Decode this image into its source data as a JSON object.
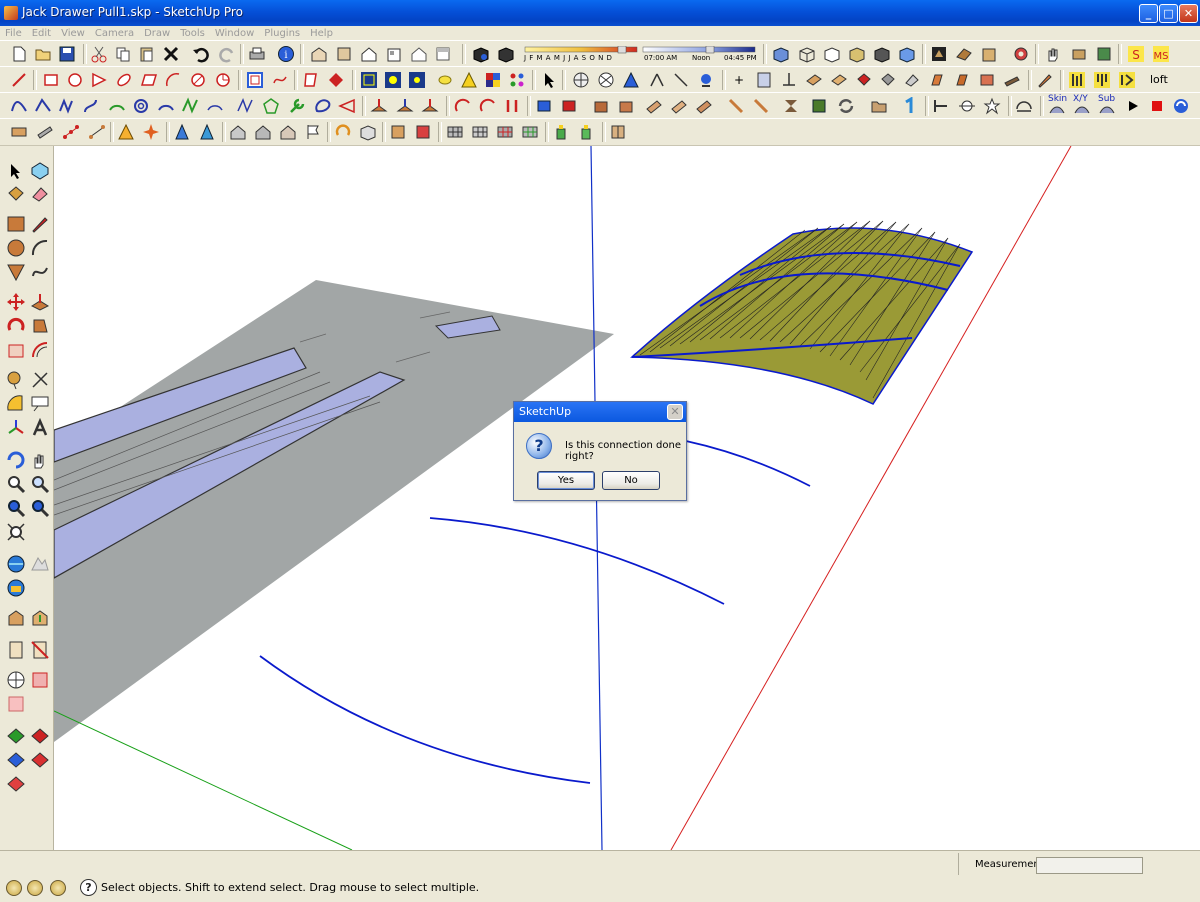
{
  "window": {
    "title": "Jack Drawer Pull1.skp - SketchUp Pro",
    "minimize": "_",
    "maximize": "□",
    "close": "✕"
  },
  "menu": [
    "File",
    "Edit",
    "View",
    "Camera",
    "Draw",
    "Tools",
    "Window",
    "Plugins",
    "Help"
  ],
  "shadow_toolbar": {
    "months": "J F M A M J J A S O N D",
    "time_start": "07:00 AM",
    "time_mid": "Noon",
    "time_end": "04:45 PM"
  },
  "plugin_toolbar": {
    "loft": "loft",
    "skin": "Skin",
    "xy": "X/Y",
    "sub": "Sub"
  },
  "dialog": {
    "title": "SketchUp",
    "icon": "?",
    "message": "Is this connection done right?",
    "yes": "Yes",
    "no": "No",
    "close": "✕"
  },
  "status": {
    "measurements_label": "Measurements",
    "measurements_value": "",
    "help_icon": "?",
    "text": "Select objects. Shift to extend select. Drag mouse to select multiple."
  },
  "colors": {
    "title_blue": "#0550d8",
    "face_olive": "#9a9a36",
    "edge_blue": "#0a1acc",
    "axis_red": "#d62020",
    "axis_green": "#18a018",
    "axis_blue": "#1030c8",
    "sheet_gray": "#a2a6a6",
    "slot_lavender": "#aab0e0"
  }
}
